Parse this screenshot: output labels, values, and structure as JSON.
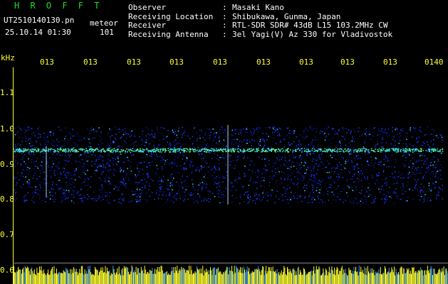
{
  "header": {
    "program": "H R O F F T",
    "filename": "UT2510140130.pn",
    "mode": "meteor",
    "datetime": "25.10.14 01:30",
    "count": "101"
  },
  "station": [
    {
      "label": "Observer",
      "value": "Masaki Kano"
    },
    {
      "label": "Receiving Location",
      "value": "Shibukawa, Gunma, Japan"
    },
    {
      "label": "Receiver",
      "value": "RTL-SDR SDR# 43dB L15 103.2MHz CW"
    },
    {
      "label": "Receiving Antenna",
      "value": "3el Yagi(V) Az 330 for Vladivostok"
    }
  ],
  "axis": {
    "unit": "kHz",
    "x_ticks": [
      "013",
      "013",
      "013",
      "013",
      "013",
      "013",
      "013",
      "013",
      "013",
      "0140"
    ],
    "y_ticks": [
      "1.1",
      "1.0",
      "0.9",
      "0.8",
      "0.7",
      "0.6"
    ]
  },
  "colors": {
    "label_green": "#22dd22",
    "axis_yellow": "#ffff33",
    "signal_blue": "#1a3cff",
    "signal_cyan": "#33e0ff",
    "noise_yellow": "#ffff33"
  }
}
